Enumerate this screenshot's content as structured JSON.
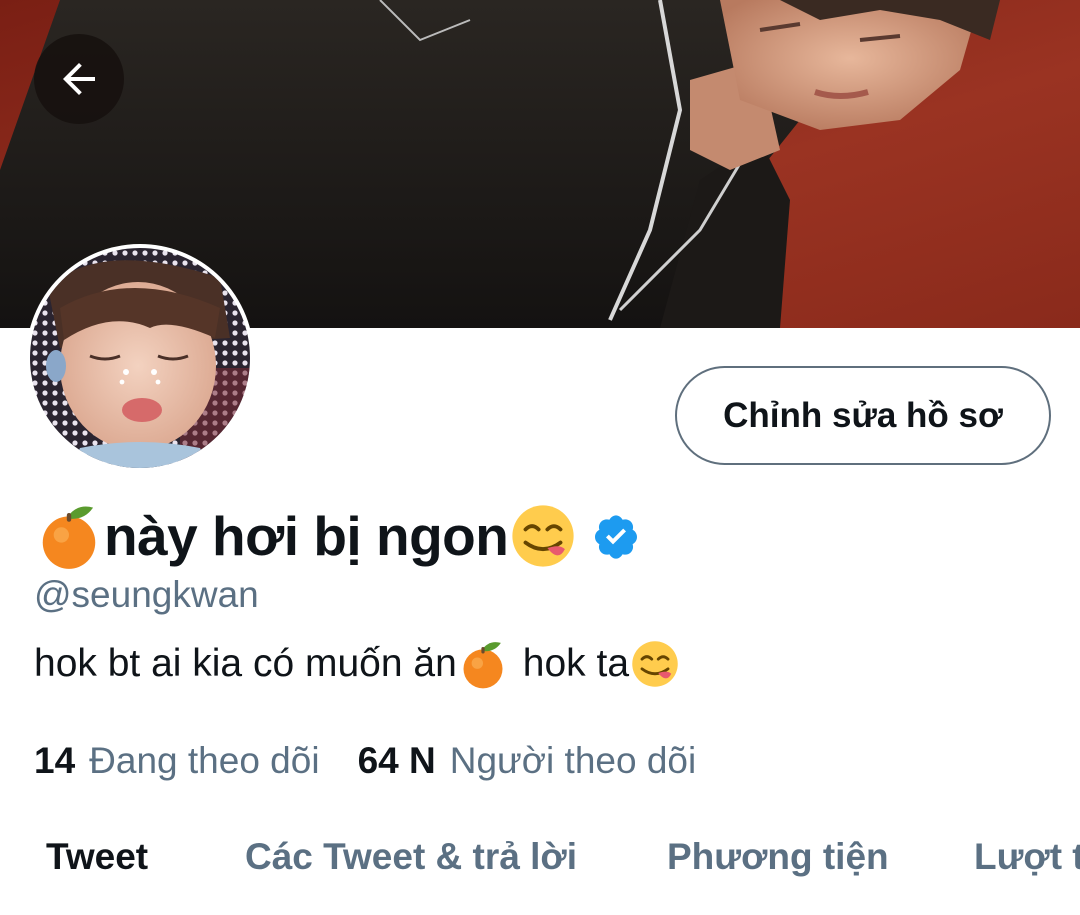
{
  "header": {
    "back_icon": "arrow-left-icon"
  },
  "profile": {
    "edit_button_label": "Chỉnh sửa hồ sơ",
    "name_prefix_emoji": "tangerine-emoji-icon",
    "name_text": "này hơi bị ngon",
    "name_suffix_emoji": "yum-face-emoji-icon",
    "verified_icon": "verified-badge-icon",
    "handle": "@seungkwan",
    "bio_part1": "hok bt ai kia có muốn ăn",
    "bio_emoji1": "tangerine-emoji-icon",
    "bio_part2": "hok ta",
    "bio_emoji2": "yum-face-emoji-icon"
  },
  "stats": {
    "following_count": "14",
    "following_label": "Đang theo dõi",
    "followers_count": "64 N",
    "followers_label": "Người theo dõi"
  },
  "tabs": [
    {
      "label": "Tweet",
      "active": true
    },
    {
      "label": "Các Tweet & trả lời",
      "active": false
    },
    {
      "label": "Phương tiện",
      "active": false
    },
    {
      "label": "Lượt thích",
      "active": false
    }
  ],
  "colors": {
    "text_primary": "#0f1419",
    "text_secondary": "#5b7083",
    "verified": "#1d9bf0",
    "banner_bg": "#8c2a1c"
  }
}
